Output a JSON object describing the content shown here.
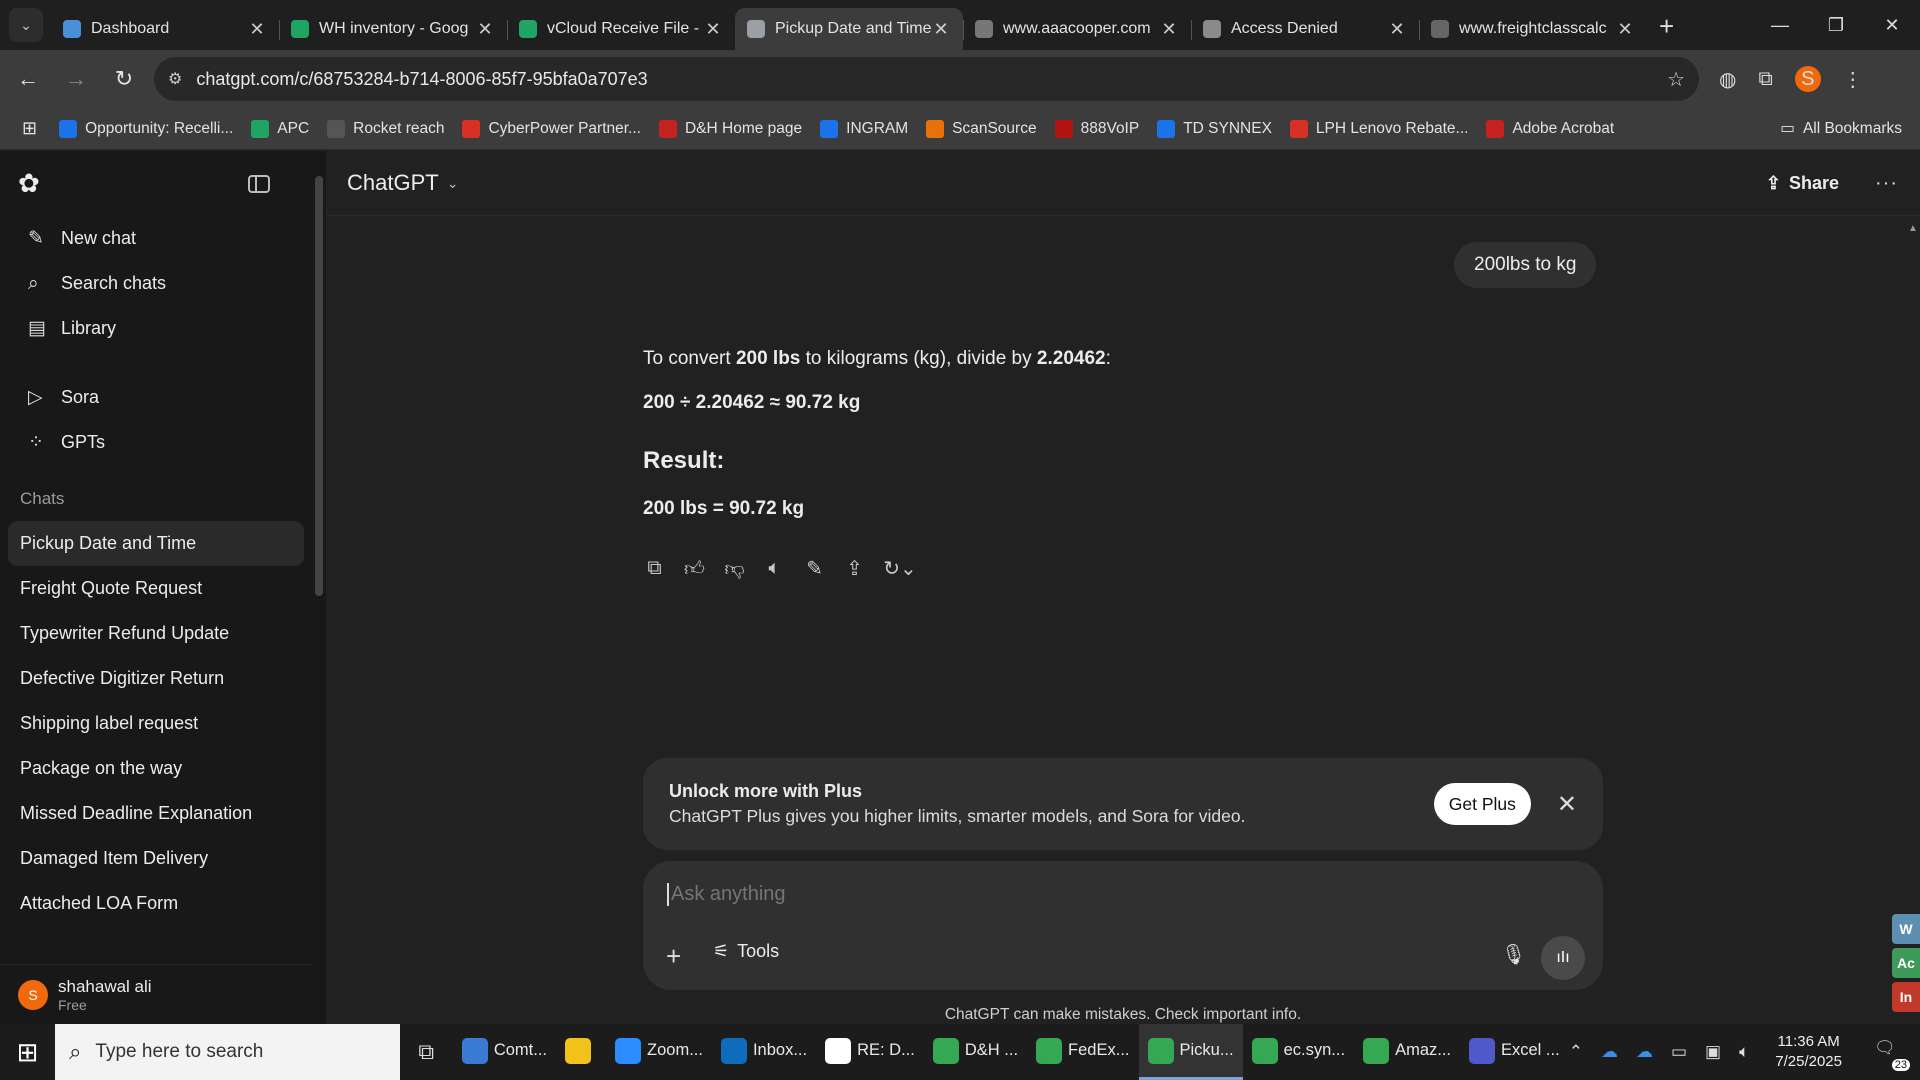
{
  "browser": {
    "tabs": [
      {
        "label": "Dashboard",
        "color": "#4a90d9"
      },
      {
        "label": "WH inventory - Goog",
        "color": "#1fa463"
      },
      {
        "label": "vCloud Receive File -",
        "color": "#1fa463"
      },
      {
        "label": "Pickup Date and Time",
        "color": "#9aa0a6",
        "active": true
      },
      {
        "label": "www.aaacooper.com",
        "color": "#777777"
      },
      {
        "label": "Access Denied",
        "color": "#8a8a8a"
      },
      {
        "label": "www.freightclasscalc",
        "color": "#666666"
      }
    ],
    "url": "chatgpt.com/c/68753284-b714-8006-85f7-95bfa0a707e3",
    "profile_initial": "S",
    "bookmarks": [
      {
        "label": "Opportunity: Recelli...",
        "color": "#1a73e8"
      },
      {
        "label": "APC",
        "color": "#1fa463"
      },
      {
        "label": "Rocket reach",
        "color": "#555555"
      },
      {
        "label": "CyberPower Partner...",
        "color": "#d93025"
      },
      {
        "label": "D&H Home page",
        "color": "#c5221f"
      },
      {
        "label": "INGRAM",
        "color": "#1a73e8"
      },
      {
        "label": "ScanSource",
        "color": "#e8710a"
      },
      {
        "label": "888VoIP",
        "color": "#b31412"
      },
      {
        "label": "TD SYNNEX",
        "color": "#1a73e8"
      },
      {
        "label": "LPH Lenovo Rebate...",
        "color": "#d93025"
      },
      {
        "label": "Adobe Acrobat",
        "color": "#c5221f"
      }
    ],
    "all_bookmarks": "All Bookmarks"
  },
  "sidebar": {
    "nav": [
      {
        "label": "New chat",
        "icon": "✎"
      },
      {
        "label": "Search chats",
        "icon": "⌕"
      },
      {
        "label": "Library",
        "icon": "▤"
      }
    ],
    "nav2": [
      {
        "label": "Sora",
        "icon": "▷"
      },
      {
        "label": "GPTs",
        "icon": "⁘"
      }
    ],
    "section_label": "Chats",
    "chats": [
      "Pickup Date and Time",
      "Freight Quote Request",
      "Typewriter Refund Update",
      "Defective Digitizer Return",
      "Shipping label request",
      "Package on the way",
      "Missed Deadline Explanation",
      "Damaged Item Delivery",
      "Attached LOA Form"
    ],
    "user": {
      "initial": "S",
      "name": "shahawal ali",
      "plan": "Free"
    }
  },
  "main": {
    "model": "ChatGPT",
    "share_label": "Share",
    "user_message": "200lbs to kg",
    "answer": {
      "line1_a": "To convert ",
      "line1_b": "200 lbs",
      "line1_c": " to kilograms (kg), divide by ",
      "line1_d": "2.20462",
      "line1_e": ":",
      "formula": "200 ÷ 2.20462 ≈ 90.72 kg",
      "result_heading": "Result:",
      "result": "200 lbs = 90.72 kg"
    },
    "upsell": {
      "title": "Unlock more with Plus",
      "body": "ChatGPT Plus gives you higher limits, smarter models, and Sora for video.",
      "button": "Get Plus"
    },
    "composer": {
      "placeholder": "Ask anything",
      "tools_label": "Tools"
    },
    "disclaimer": "ChatGPT can make mistakes. Check important info.",
    "side_tabs": [
      "W",
      "Ac",
      "In"
    ]
  },
  "taskbar": {
    "search_placeholder": "Type here to search",
    "apps": [
      {
        "label": "Comt...",
        "color": "#3a7bd5"
      },
      {
        "label": "",
        "color": "#f2c21b"
      },
      {
        "label": "Zoom...",
        "color": "#2d8cff"
      },
      {
        "label": "Inbox...",
        "color": "#0f6cbd"
      },
      {
        "label": "RE: D...",
        "color": "#ffffff"
      },
      {
        "label": "D&H ...",
        "color": "#34a853"
      },
      {
        "label": "FedEx...",
        "color": "#34a853"
      },
      {
        "label": "Picku...",
        "color": "#34a853",
        "active": true
      },
      {
        "label": "ec.syn...",
        "color": "#34a853"
      },
      {
        "label": "Amaz...",
        "color": "#34a853"
      },
      {
        "label": "Excel ...",
        "color": "#5059c9"
      }
    ],
    "time": "11:36 AM",
    "date": "7/25/2025",
    "notifications": "23"
  }
}
